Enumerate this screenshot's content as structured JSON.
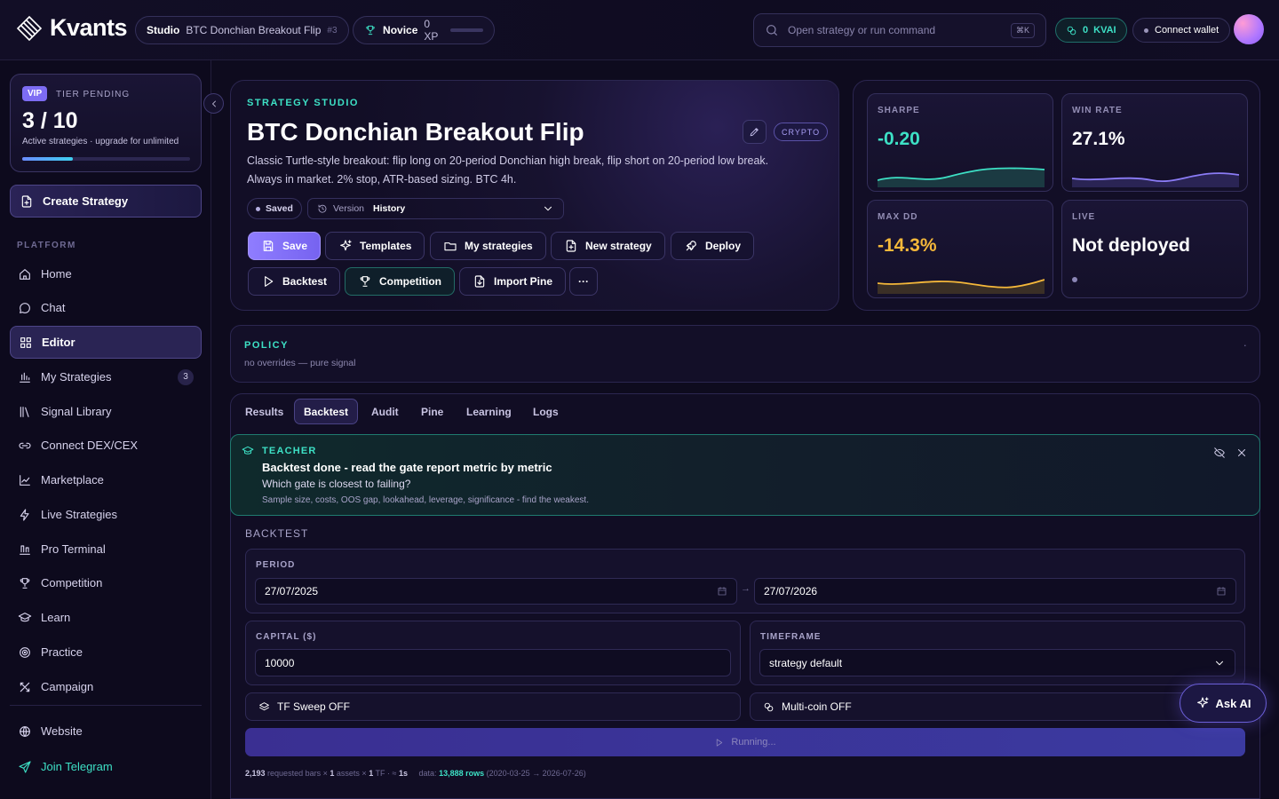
{
  "app": {
    "brand": "Kvants"
  },
  "topbar": {
    "crumb_section": "Studio",
    "crumb_strategy": "BTC Donchian Breakout Flip",
    "crumb_number": "#3",
    "level": "Novice",
    "xp": "0 XP",
    "search_placeholder": "Open strategy or run command",
    "search_shortcut": "⌘K",
    "kvai_balance": "0",
    "kvai_unit": "KVAI",
    "wallet_label": "Connect wallet"
  },
  "sidebar": {
    "vip_badge": "VIP",
    "tier": "TIER PENDING",
    "count": "3 / 10",
    "count_note": "Active strategies · upgrade for unlimited",
    "usage_fraction": 0.3,
    "create_label": "Create Strategy",
    "section_label": "PLATFORM",
    "items": [
      {
        "label": "Home",
        "icon": "home-icon"
      },
      {
        "label": "Chat",
        "icon": "chat-icon"
      },
      {
        "label": "Editor",
        "icon": "grid-icon",
        "active": true
      },
      {
        "label": "My Strategies",
        "icon": "bar-chart-icon",
        "badge": "3"
      },
      {
        "label": "Signal Library",
        "icon": "library-icon"
      },
      {
        "label": "Connect DEX/CEX",
        "icon": "link-icon"
      },
      {
        "label": "Marketplace",
        "icon": "line-chart-icon"
      },
      {
        "label": "Live Strategies",
        "icon": "bolt-icon"
      },
      {
        "label": "Pro Terminal",
        "icon": "terminal-icon"
      },
      {
        "label": "Competition",
        "icon": "trophy-icon"
      },
      {
        "label": "Learn",
        "icon": "graduation-icon"
      },
      {
        "label": "Practice",
        "icon": "target-icon"
      },
      {
        "label": "Campaign",
        "icon": "campaign-icon"
      }
    ],
    "website": "Website",
    "telegram": "Join Telegram"
  },
  "header": {
    "section_label": "STRATEGY STUDIO",
    "title": "BTC Donchian Breakout Flip",
    "category": "CRYPTO",
    "description": "Classic Turtle-style breakout: flip long on 20-period Donchian high break, flip short on 20-period low break. Always in market. 2% stop, ATR-based sizing. BTC 4h.",
    "saved": "Saved",
    "version_label": "Version",
    "version_value": "History",
    "actions": {
      "save": "Save",
      "templates": "Templates",
      "my_strategies": "My strategies",
      "new_strategy": "New strategy",
      "deploy": "Deploy",
      "backtest": "Backtest",
      "competition": "Competition",
      "import_pine": "Import Pine",
      "more": "···"
    }
  },
  "stats": {
    "sharpe": {
      "label": "SHARPE",
      "value": "-0.20",
      "color": "#3de0c5"
    },
    "win_rate": {
      "label": "WIN RATE",
      "value": "27.1%",
      "color": "#ffffff"
    },
    "max_dd": {
      "label": "MAX DD",
      "value": "-14.3%",
      "color": "#f5b83a"
    },
    "live": {
      "label": "LIVE",
      "value": "Not deployed"
    }
  },
  "policy": {
    "label": "POLICY",
    "text": "no overrides — pure signal",
    "dot": "·"
  },
  "tabs": [
    "Results",
    "Backtest",
    "Audit",
    "Pine",
    "Learning",
    "Logs"
  ],
  "active_tab": "Backtest",
  "teacher": {
    "label": "TEACHER",
    "headline": "Backtest done - read the gate report metric by metric",
    "question": "Which gate is closest to failing?",
    "note": "Sample size, costs, OOS gap, lookahead, leverage, significance - find the weakest."
  },
  "backtest": {
    "section_label": "BACKTEST",
    "period_label": "PERIOD",
    "start_date": "27/07/2025",
    "end_date": "27/07/2026",
    "arrow": "→",
    "capital_label": "CAPITAL ($)",
    "capital": "10000",
    "timeframe_label": "TIMEFRAME",
    "timeframe": "strategy default",
    "tf_sweep": "TF Sweep OFF",
    "multi_coin": "Multi-coin OFF",
    "run_status": "Running...",
    "footer": {
      "bars": "2,193",
      "bars_note": "requested bars ×",
      "assets": "1",
      "assets_note": "assets ×",
      "tf": "1",
      "tf_note": "TF · ≈",
      "time": "1s",
      "data_label": "data:",
      "rows": "13,888 rows",
      "range": "(2020-03-25 → 2026-07-26)"
    }
  },
  "ask_ai": "Ask AI"
}
